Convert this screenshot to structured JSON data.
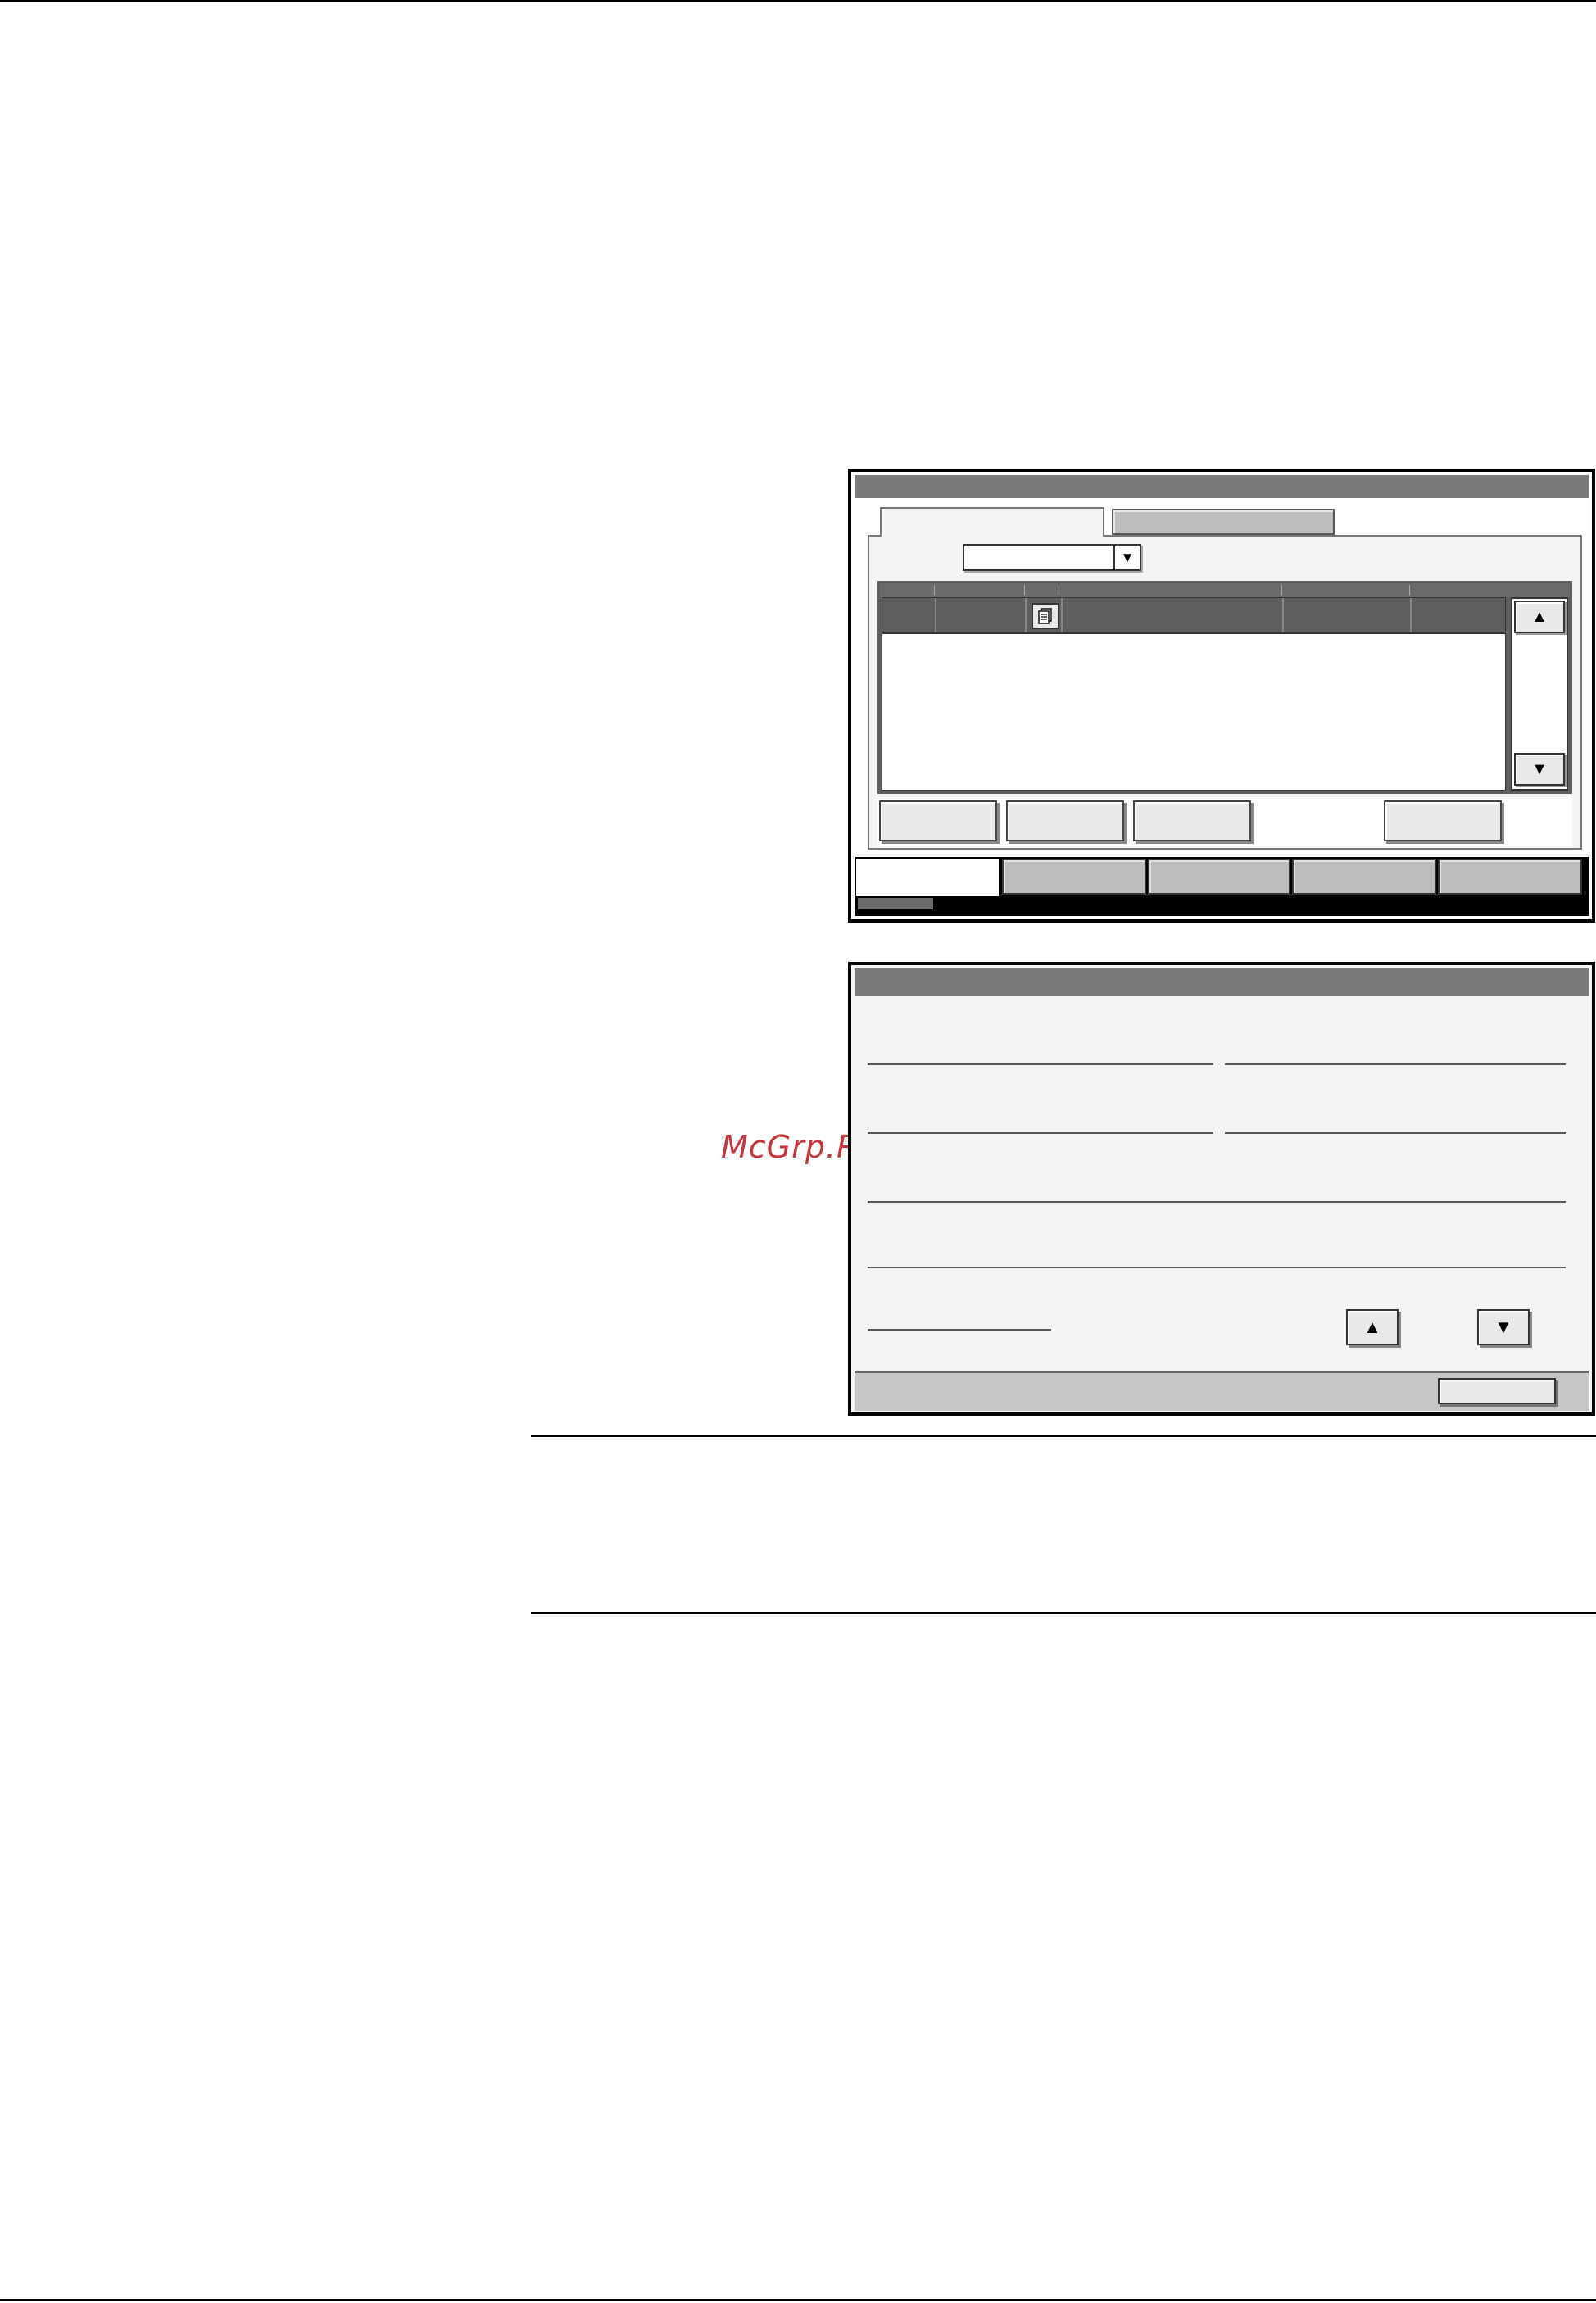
{
  "watermark": {
    "text": "McGrp.Ru"
  },
  "job_status_screen": {
    "job_list": {
      "selected_row": {
        "icon": "copy-job-icon"
      }
    },
    "scroll": {
      "up_icon": "▲",
      "down_icon": "▼"
    },
    "dropdown": {
      "arrow_icon": "▼"
    }
  },
  "detail_screen": {
    "step_up_icon": "▲",
    "step_down_icon": "▼"
  },
  "colors": {
    "panel_background": "#f4f4f4",
    "title_bar": "#7a7a7a",
    "selected_row": "#5e5e5e",
    "button_face": "#e9e9e9",
    "inactive_tab": "#bdbdbd",
    "watermark": "#c8343c"
  }
}
